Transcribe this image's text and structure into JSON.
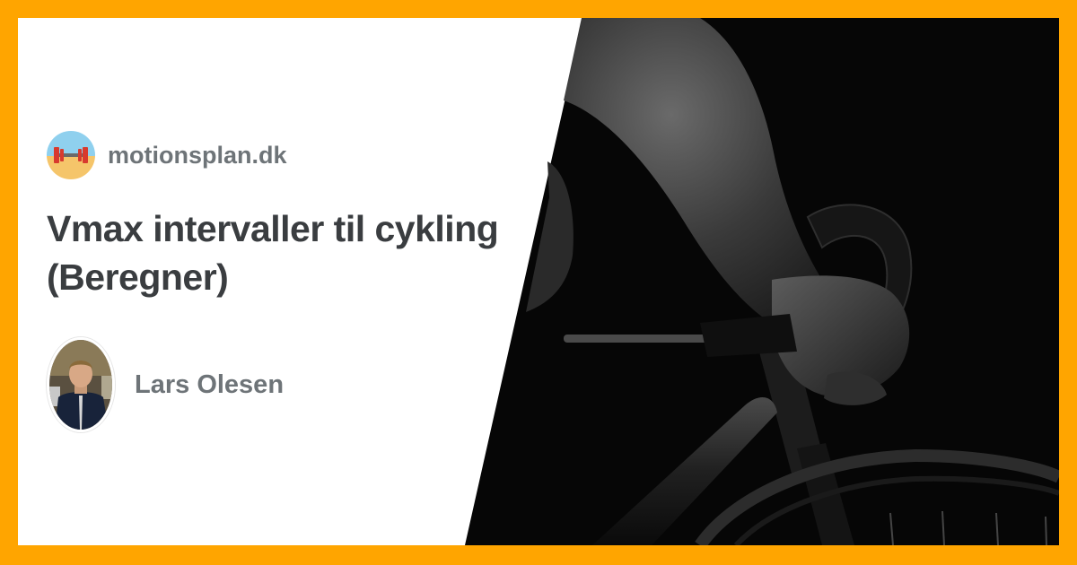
{
  "site": {
    "name": "motionsplan.dk",
    "logo_icon": "dumbbell-beach-icon"
  },
  "article": {
    "title": "Vmax intervaller til cykling (Beregner)"
  },
  "author": {
    "name": "Lars Olesen",
    "avatar_icon": "author-portrait"
  },
  "hero_image": {
    "subject": "cyclist-on-bike-photo"
  },
  "colors": {
    "border": "#ffa500",
    "background": "#ffffff",
    "text_dark": "#3a3d40",
    "text_muted": "#6e7478",
    "photo_bg": "#060606"
  }
}
